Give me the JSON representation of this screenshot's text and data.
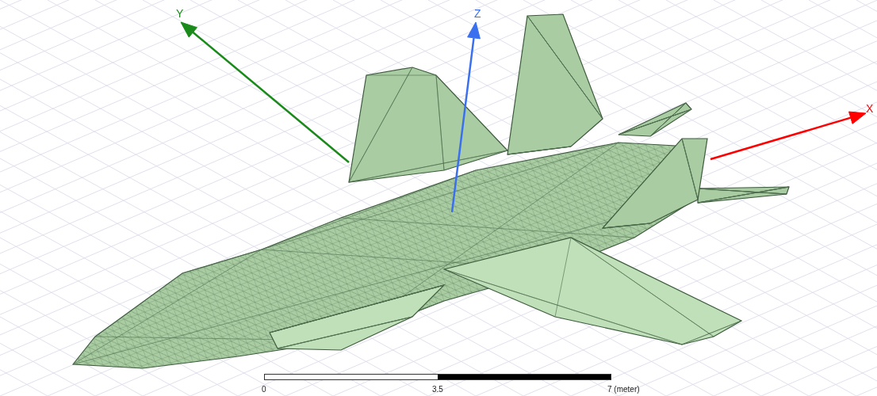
{
  "axes": [
    {
      "label": "Y",
      "color": "#1a8a1a"
    },
    {
      "label": "Z",
      "color": "#3a6ff0"
    },
    {
      "label": "X",
      "color": "#ff0000"
    }
  ],
  "scale_bar": {
    "ticks": [
      "0",
      "3.5",
      "7 (meter)"
    ]
  }
}
